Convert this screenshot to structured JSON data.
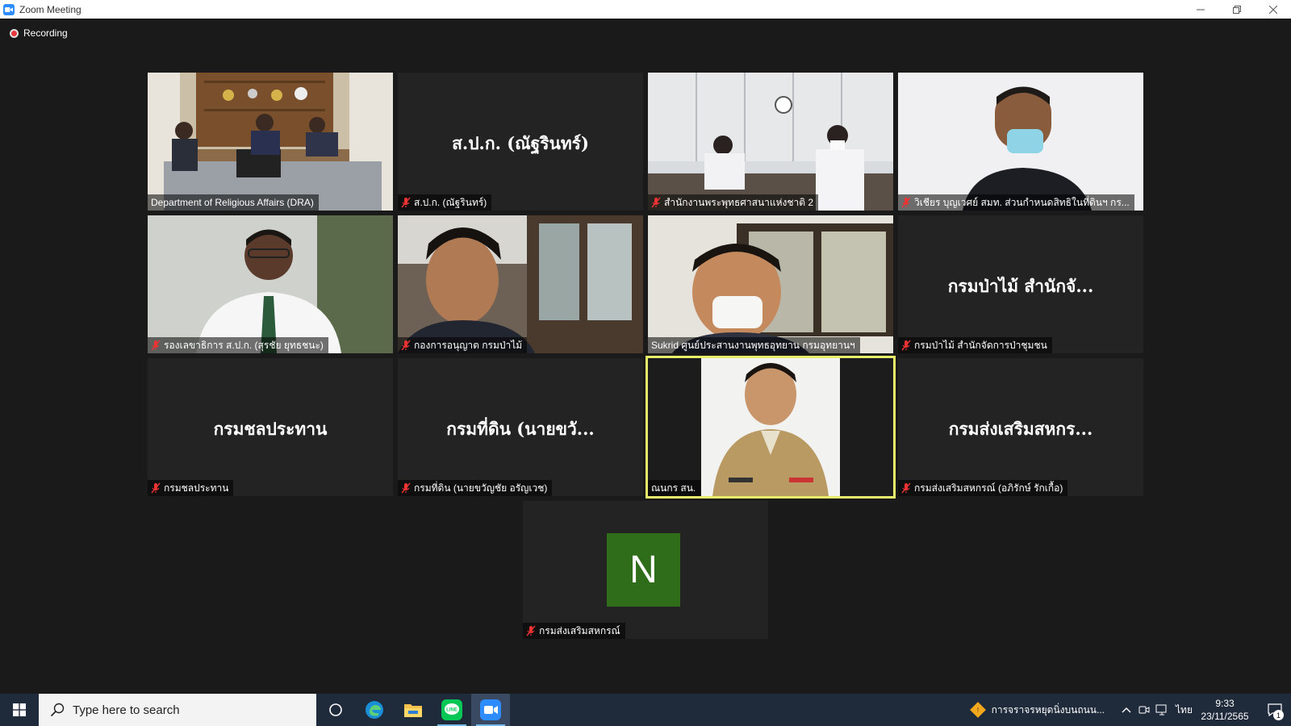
{
  "window": {
    "title": "Zoom Meeting",
    "minimize_icon": "minimize-icon",
    "restore_icon": "restore-icon",
    "close_icon": "close-icon"
  },
  "recording": {
    "label": "Recording"
  },
  "participants": [
    {
      "name": "Department of Religious Affairs (DRA)",
      "muted": false,
      "video": true,
      "active": false
    },
    {
      "name": "ส.ป.ก. (ณัฐรินทร์)",
      "display_name": "ส.ป.ก. (ณัฐรินทร์)",
      "muted": true,
      "video": false,
      "active": false
    },
    {
      "name": "สำนักงานพระพุทธศาสนาแห่งชาติ 2",
      "muted": true,
      "video": true,
      "active": false
    },
    {
      "name": "วิเชียร  บุญเวศย์ สมท. ส่วนกำหนดสิทธิในที่ดินฯ  กร...",
      "muted": true,
      "video": true,
      "active": false
    },
    {
      "name": "รองเลขาธิการ ส.ป.ก. (สุรชัย ยุทธชนะ)",
      "muted": true,
      "video": true,
      "active": false
    },
    {
      "name": "กองการอนุญาต กรมป่าไม้",
      "muted": true,
      "video": true,
      "active": false
    },
    {
      "name": "Sukrid ศูนย์ประสานงานพุทธอุทยาน กรมอุทยานฯ",
      "muted": false,
      "video": true,
      "active": false
    },
    {
      "name": "กรมป่าไม้ สำนักจัดการป่าชุมชน",
      "display_name": "กรมป่าไม้ สำนักจั...",
      "muted": true,
      "video": false,
      "active": false
    },
    {
      "name": "กรมชลประทาน",
      "display_name": "กรมชลประทาน",
      "muted": true,
      "video": false,
      "active": false
    },
    {
      "name": "กรมที่ดิน (นายขวัญชัย อรัญเวช)",
      "display_name": "กรมที่ดิน (นายขวั...",
      "muted": true,
      "video": false,
      "active": false
    },
    {
      "name": "ณนกร สน.",
      "muted": false,
      "video": true,
      "active": true
    },
    {
      "name": "กรมส่งเสริมสหกรณ์ (อภิรักษ์  รักเกื้อ)",
      "display_name": "กรมส่งเสริมสหกร...",
      "muted": true,
      "video": false,
      "active": false
    },
    {
      "name": "กรมส่งเสริมสหกรณ์",
      "avatar_letter": "N",
      "avatar_color": "#2f6d1b",
      "muted": true,
      "video": false,
      "active": false
    }
  ],
  "taskbar": {
    "search_placeholder": "Type here to search",
    "apps": [
      "cortana-icon",
      "edge-icon",
      "file-explorer-icon",
      "line-icon",
      "zoom-icon"
    ],
    "news": "การจราจรหยุดนิ่งบนถนน...",
    "language": "ไทย",
    "time": "9:33",
    "date": "23/11/2565",
    "notification_count": "1"
  },
  "colors": {
    "background": "#1a1a1a",
    "tile": "#232323",
    "active_border": "#e8f06a",
    "taskbar": "#1f2a3b",
    "recording": "#e8383d",
    "zoom_blue": "#2d8cff"
  }
}
